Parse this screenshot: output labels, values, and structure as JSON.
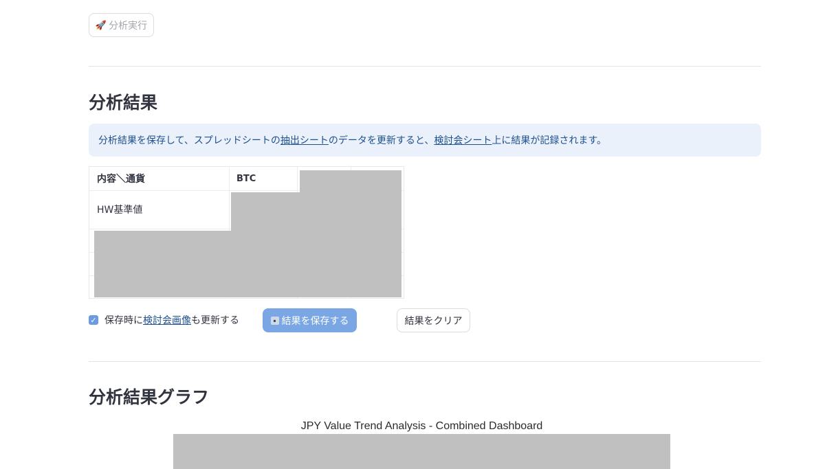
{
  "actions": {
    "run_icon": "rocket-icon",
    "run_label": "分析実行"
  },
  "results": {
    "title": "分析結果",
    "info": {
      "part1": "分析結果を保存して、スプレッドシートの",
      "link1": "抽出シート",
      "part2": "のデータを更新すると、",
      "link2": "検討会シート",
      "part3": "上に結果が記録されます。"
    },
    "table": {
      "header_label": "内容＼通貨",
      "columns": [
        "BTC"
      ],
      "rows": [
        {
          "label": "HW基準値"
        }
      ]
    },
    "checkbox": {
      "checked": true,
      "part1": "保存時に",
      "link": "検討会画像",
      "part2": "も更新する"
    },
    "save_icon": "floppy-disk-icon",
    "save_label": "結果を保存する",
    "clear_label": "結果をクリア"
  },
  "graph": {
    "title": "分析結果グラフ",
    "chart_title": "JPY Value Trend Analysis - Combined Dashboard"
  },
  "colors": {
    "info_bg": "#eaf1fb",
    "info_text": "#1e4f8f",
    "primary_button": "#7aa6e4",
    "redaction": "#c0c0c0"
  }
}
